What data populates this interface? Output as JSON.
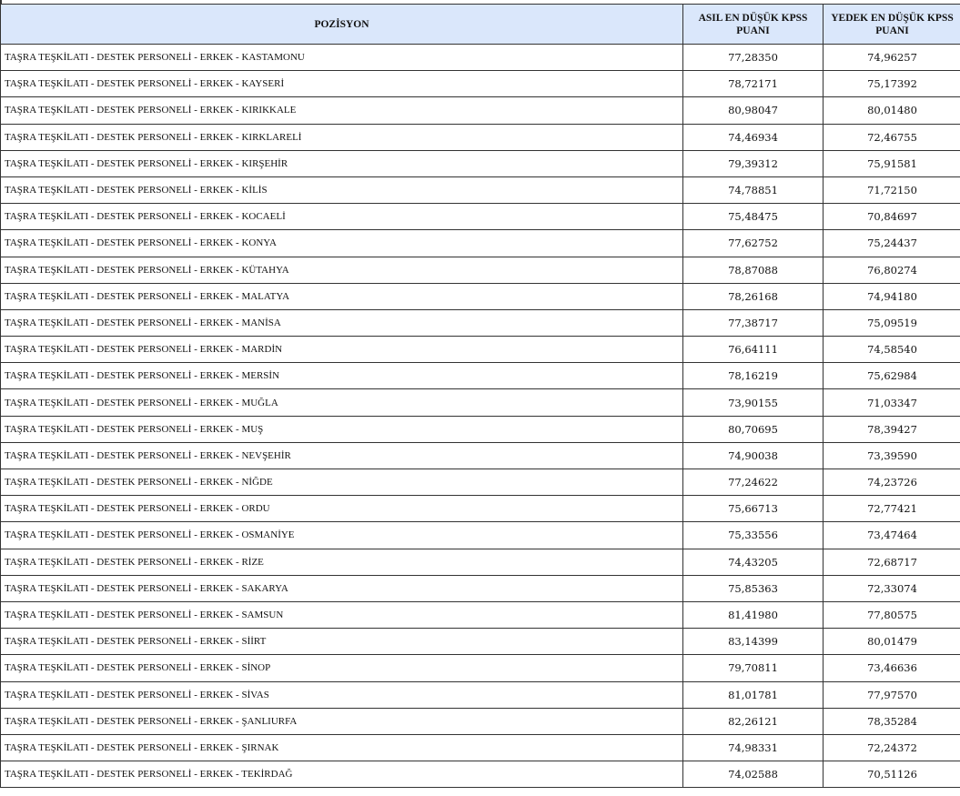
{
  "table": {
    "headers": [
      "POZİSYON",
      "ASIL EN DÜŞÜK KPSS PUANI",
      "YEDEK EN DÜŞÜK KPSS PUANI"
    ],
    "rows": [
      [
        "TAŞRA TEŞKİLATI - DESTEK PERSONELİ - ERKEK - KASTAMONU",
        "77,28350",
        "74,96257"
      ],
      [
        "TAŞRA TEŞKİLATI - DESTEK PERSONELİ - ERKEK - KAYSERİ",
        "78,72171",
        "75,17392"
      ],
      [
        "TAŞRA TEŞKİLATI - DESTEK PERSONELİ - ERKEK - KIRIKKALE",
        "80,98047",
        "80,01480"
      ],
      [
        "TAŞRA TEŞKİLATI - DESTEK PERSONELİ - ERKEK - KIRKLARELİ",
        "74,46934",
        "72,46755"
      ],
      [
        "TAŞRA TEŞKİLATI - DESTEK PERSONELİ - ERKEK - KIRŞEHİR",
        "79,39312",
        "75,91581"
      ],
      [
        "TAŞRA TEŞKİLATI - DESTEK PERSONELİ - ERKEK - KİLİS",
        "74,78851",
        "71,72150"
      ],
      [
        "TAŞRA TEŞKİLATI - DESTEK PERSONELİ - ERKEK - KOCAELİ",
        "75,48475",
        "70,84697"
      ],
      [
        "TAŞRA TEŞKİLATI - DESTEK PERSONELİ - ERKEK - KONYA",
        "77,62752",
        "75,24437"
      ],
      [
        "TAŞRA TEŞKİLATI - DESTEK PERSONELİ - ERKEK - KÜTAHYA",
        "78,87088",
        "76,80274"
      ],
      [
        "TAŞRA TEŞKİLATI - DESTEK PERSONELİ - ERKEK - MALATYA",
        "78,26168",
        "74,94180"
      ],
      [
        "TAŞRA TEŞKİLATI - DESTEK PERSONELİ - ERKEK - MANİSA",
        "77,38717",
        "75,09519"
      ],
      [
        "TAŞRA TEŞKİLATI - DESTEK PERSONELİ - ERKEK - MARDİN",
        "76,64111",
        "74,58540"
      ],
      [
        "TAŞRA TEŞKİLATI - DESTEK PERSONELİ - ERKEK - MERSİN",
        "78,16219",
        "75,62984"
      ],
      [
        "TAŞRA TEŞKİLATI - DESTEK PERSONELİ - ERKEK - MUĞLA",
        "73,90155",
        "71,03347"
      ],
      [
        "TAŞRA TEŞKİLATI - DESTEK PERSONELİ - ERKEK - MUŞ",
        "80,70695",
        "78,39427"
      ],
      [
        "TAŞRA TEŞKİLATI - DESTEK PERSONELİ - ERKEK - NEVŞEHİR",
        "74,90038",
        "73,39590"
      ],
      [
        "TAŞRA TEŞKİLATI - DESTEK PERSONELİ - ERKEK - NİĞDE",
        "77,24622",
        "74,23726"
      ],
      [
        "TAŞRA TEŞKİLATI - DESTEK PERSONELİ - ERKEK - ORDU",
        "75,66713",
        "72,77421"
      ],
      [
        "TAŞRA TEŞKİLATI - DESTEK PERSONELİ - ERKEK - OSMANİYE",
        "75,33556",
        "73,47464"
      ],
      [
        "TAŞRA TEŞKİLATI - DESTEK PERSONELİ - ERKEK - RİZE",
        "74,43205",
        "72,68717"
      ],
      [
        "TAŞRA TEŞKİLATI - DESTEK PERSONELİ - ERKEK - SAKARYA",
        "75,85363",
        "72,33074"
      ],
      [
        "TAŞRA TEŞKİLATI - DESTEK PERSONELİ - ERKEK - SAMSUN",
        "81,41980",
        "77,80575"
      ],
      [
        "TAŞRA TEŞKİLATI - DESTEK PERSONELİ - ERKEK - SİİRT",
        "83,14399",
        "80,01479"
      ],
      [
        "TAŞRA TEŞKİLATI - DESTEK PERSONELİ - ERKEK - SİNOP",
        "79,70811",
        "73,46636"
      ],
      [
        "TAŞRA TEŞKİLATI - DESTEK PERSONELİ - ERKEK - SİVAS",
        "81,01781",
        "77,97570"
      ],
      [
        "TAŞRA TEŞKİLATI - DESTEK PERSONELİ - ERKEK - ŞANLIURFA",
        "82,26121",
        "78,35284"
      ],
      [
        "TAŞRA TEŞKİLATI - DESTEK PERSONELİ - ERKEK - ŞIRNAK",
        "74,98331",
        "72,24372"
      ],
      [
        "TAŞRA TEŞKİLATI - DESTEK PERSONELİ - ERKEK - TEKİRDAĞ",
        "74,02588",
        "70,51126"
      ]
    ]
  }
}
